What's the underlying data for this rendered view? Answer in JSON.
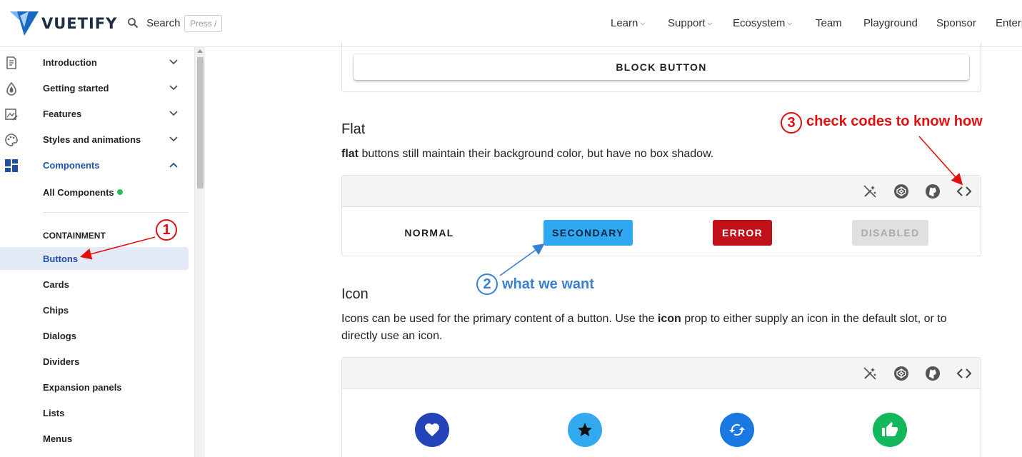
{
  "header": {
    "brand": "VUETIFY",
    "search_label": "Search",
    "search_shortcut": "Press /",
    "nav": [
      {
        "label": "Learn",
        "has_menu": true
      },
      {
        "label": "Support",
        "has_menu": true
      },
      {
        "label": "Ecosystem",
        "has_menu": true
      },
      {
        "label": "Team",
        "has_menu": false
      },
      {
        "label": "Playground",
        "has_menu": false
      },
      {
        "label": "Sponsor",
        "has_menu": false
      },
      {
        "label": "Enterp",
        "has_menu": false
      }
    ]
  },
  "sidebar": {
    "groups": [
      {
        "label": "Introduction",
        "icon": "document-icon"
      },
      {
        "label": "Getting started",
        "icon": "droplet-icon"
      },
      {
        "label": "Features",
        "icon": "image-edit-icon"
      },
      {
        "label": "Styles and animations",
        "icon": "palette-icon"
      },
      {
        "label": "Components",
        "icon": "dashboard-icon",
        "expanded": true
      }
    ],
    "all_components": "All Components",
    "section_heading": "CONTAINMENT",
    "items": [
      "Buttons",
      "Cards",
      "Chips",
      "Dialogs",
      "Dividers",
      "Expansion panels",
      "Lists",
      "Menus"
    ],
    "selected": "Buttons"
  },
  "main": {
    "block_button": "BLOCK BUTTON",
    "flat": {
      "title": "Flat",
      "desc_bold": "flat",
      "desc_rest": " buttons still maintain their background color, but have no box shadow.",
      "buttons": [
        {
          "label": "NORMAL",
          "style": "text"
        },
        {
          "label": "SECONDARY",
          "color": "#2ea8f1"
        },
        {
          "label": "ERROR",
          "color": "#c0101a"
        },
        {
          "label": "DISABLED",
          "color": "#e0e0e0"
        }
      ]
    },
    "icon": {
      "title": "Icon",
      "desc_a": "Icons can be used for the primary content of a button. Use the ",
      "desc_bold": "icon",
      "desc_b": " prop to either supply an icon in the default slot, or to directly use an icon.",
      "buttons": [
        {
          "icon": "heart-icon",
          "color": "#2543b8"
        },
        {
          "icon": "star-icon",
          "color": "#33aaf0"
        },
        {
          "icon": "cached-icon",
          "color": "#1a78e0"
        },
        {
          "icon": "thumb-up-icon",
          "color": "#13b85a"
        }
      ]
    },
    "toolbar_icons": [
      "magic-wand-off-icon",
      "codepen-icon",
      "github-icon",
      "code-icon"
    ]
  },
  "annotations": {
    "note1": "1",
    "note2": "2",
    "note2_text": "what we want",
    "note3": "3",
    "note3_text": "check codes to know how",
    "red": "#e01010",
    "blue": "#3a7fd0"
  }
}
